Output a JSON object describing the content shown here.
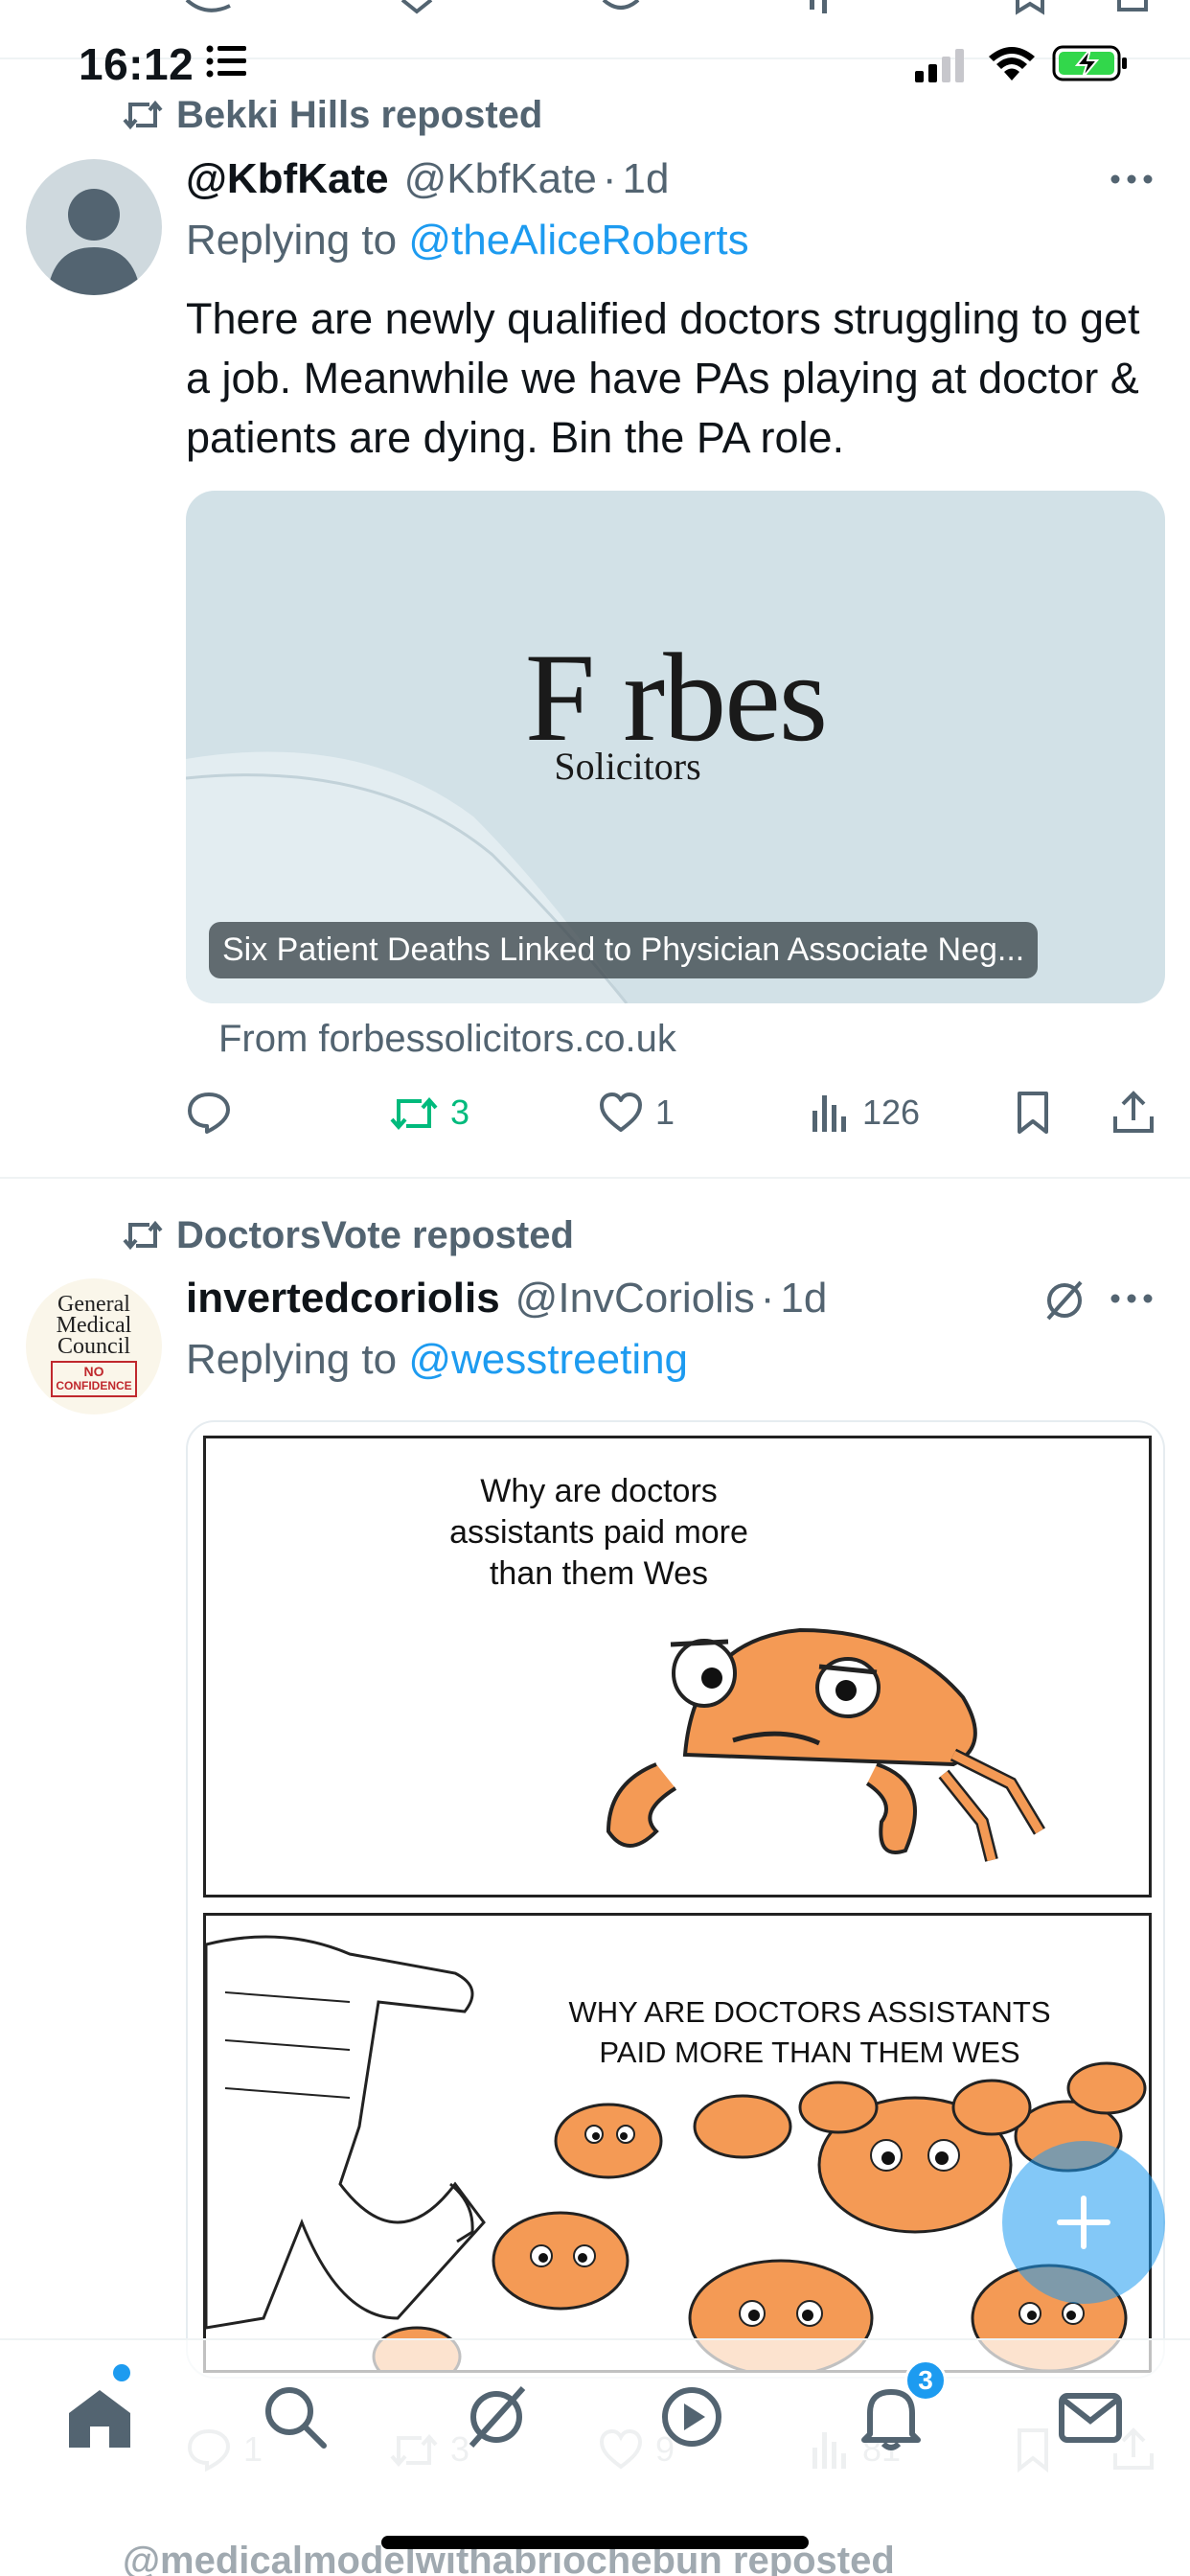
{
  "status_bar": {
    "time": "16:12"
  },
  "tweets": [
    {
      "repost_by": "Bekki Hills reposted",
      "display_name": "@KbfKate",
      "handle": "@KbfKate",
      "dot": "·",
      "time_ago": "1d",
      "replying_prefix": "Replying to ",
      "replying_to": "@theAliceRoberts",
      "text": "There are newly qualified doctors struggling to get a job. Meanwhile we have PAs playing at doctor & patients are dying.  Bin the PA role.",
      "card": {
        "logo_main": "F rbes",
        "logo_sub": "Solicitors",
        "title": "Six Patient Deaths Linked to Physician Associate Neg...",
        "source": "From forbessolicitors.co.uk"
      },
      "actions": {
        "replies": "",
        "reposts": "3",
        "likes": "1",
        "views": "126"
      }
    },
    {
      "repost_by": "DoctorsVote reposted",
      "display_name": "invertedcoriolis",
      "handle": "@InvCoriolis",
      "dot": "·",
      "time_ago": "1d",
      "replying_prefix": "Replying to ",
      "replying_to": "@wesstreeting",
      "avatar": {
        "line1": "General",
        "line2": "Medical",
        "line3": "Council",
        "stamp1": "NO",
        "stamp2": "CONFIDENCE"
      },
      "meme": {
        "panel1_text": "Why are doctors assistants paid more than them Wes",
        "panel2_text": "WHY ARE DOCTORS ASSISTANTS PAID MORE THAN THEM WES"
      },
      "actions": {
        "replies": "1",
        "reposts": "3",
        "likes": "9",
        "views": "81"
      }
    }
  ],
  "next_repost": "@medicalmodelwithabriochebun reposted",
  "bottom_nav": {
    "notifications_badge": "3",
    "items": [
      "home-icon",
      "search-icon",
      "grok-icon",
      "video-icon",
      "notifications-icon",
      "messages-icon"
    ]
  },
  "colors": {
    "accent": "#1d9bf0",
    "repost_green": "#00ba7c",
    "secondary_text": "#536471"
  }
}
